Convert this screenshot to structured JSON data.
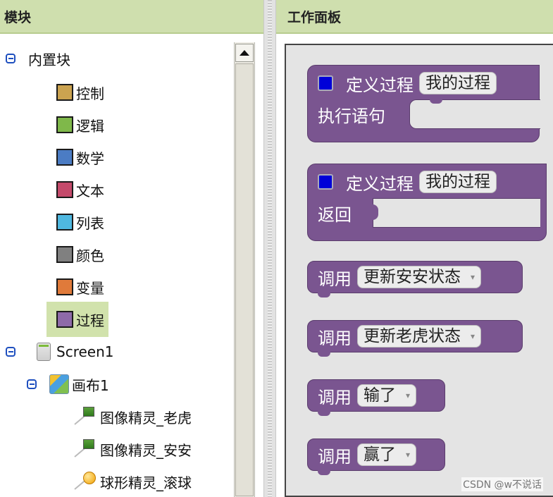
{
  "left": {
    "header": "模块",
    "builtin": {
      "label": "内置块"
    },
    "categories": [
      {
        "label": "控制",
        "color": "#cba350"
      },
      {
        "label": "逻辑",
        "color": "#7fb84a"
      },
      {
        "label": "数学",
        "color": "#4b7cc4"
      },
      {
        "label": "文本",
        "color": "#c44a6b"
      },
      {
        "label": "列表",
        "color": "#4fb8e0"
      },
      {
        "label": "颜色",
        "color": "#808080"
      },
      {
        "label": "变量",
        "color": "#e07a3a"
      },
      {
        "label": "过程",
        "color": "#8e6aa8"
      }
    ],
    "screen": {
      "label": "Screen1"
    },
    "canvas": {
      "label": "画布1"
    },
    "sprites": [
      {
        "label": "图像精灵_老虎"
      },
      {
        "label": "图像精灵_安安"
      },
      {
        "label": "球形精灵_滚球"
      }
    ]
  },
  "right": {
    "header": "工作面板",
    "def1": {
      "keyword": "定义过程",
      "name": "我的过程",
      "body_label": "执行语句"
    },
    "def2": {
      "keyword": "定义过程",
      "name": "我的过程",
      "body_label": "返回"
    },
    "calls": [
      {
        "keyword": "调用",
        "name": "更新安安状态"
      },
      {
        "keyword": "调用",
        "name": "更新老虎状态"
      },
      {
        "keyword": "调用",
        "name": "输了"
      },
      {
        "keyword": "调用",
        "name": "赢了"
      }
    ],
    "caret": "▾"
  },
  "watermark": "CSDN @w不说话",
  "colors": {
    "procedure_block": "#7a5590",
    "header_bg": "#cfdfae",
    "selected_bg": "#d1e2ac"
  }
}
